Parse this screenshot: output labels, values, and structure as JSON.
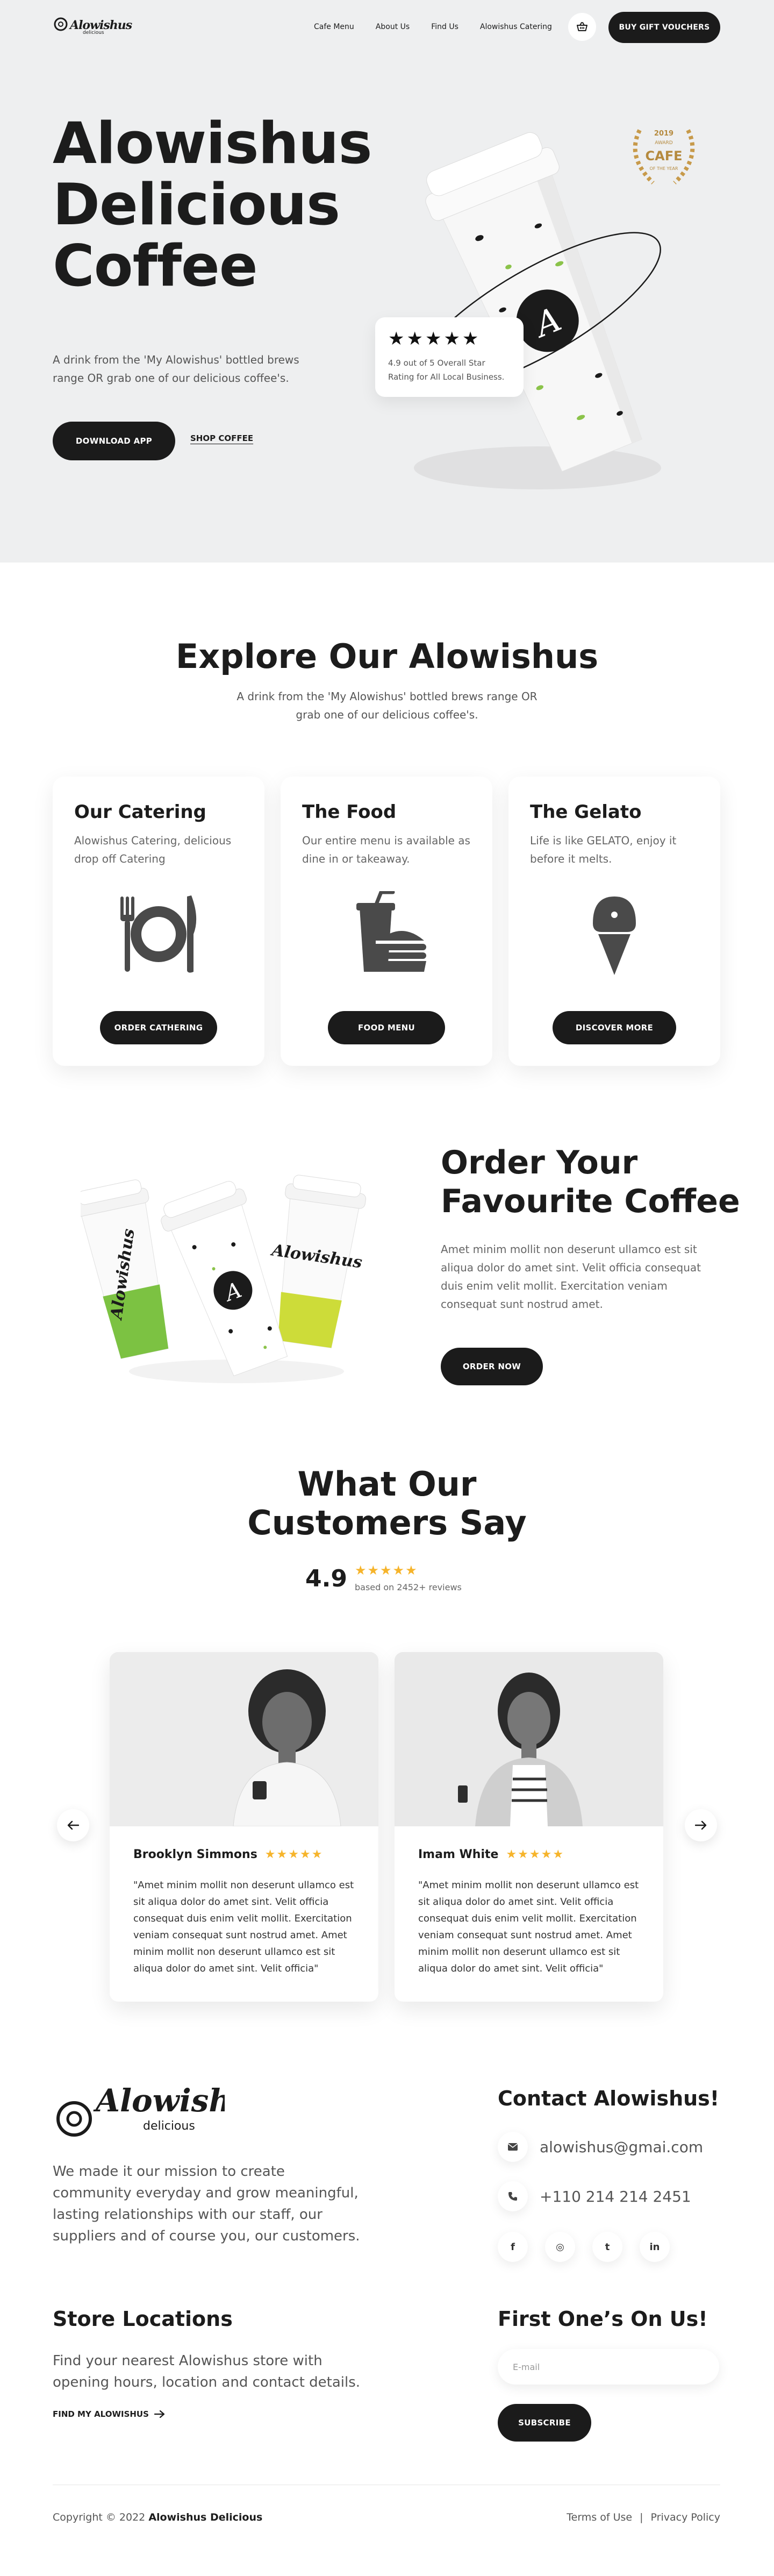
{
  "header": {
    "logo_script": "Alowishus",
    "logo_sub": "delicious",
    "nav": [
      "Cafe Menu",
      "About Us",
      "Find Us",
      "Alowishus Catering"
    ],
    "gift_button": "BUY GIFT VOUCHERS"
  },
  "hero": {
    "title_lines": [
      "Alowishus",
      "Delicious",
      "Coffee"
    ],
    "description": "A drink from the 'My Alowishus' bottled brews range OR grab one of our delicious coffee's.",
    "download_button": "DOWNLOAD APP",
    "shop_link": "SHOP COFFEE",
    "award_lines": [
      "2019",
      "AWARD",
      "CAFE",
      "OF THE YEAR"
    ],
    "rating_stars": "★★★★★",
    "rating_text": "4.9 out of 5 Overall Star Rating for All Local Business."
  },
  "explore": {
    "title": "Explore Our Alowishus",
    "description": "A drink from the 'My Alowishus' bottled brews range OR grab one of our delicious coffee's.",
    "cards": [
      {
        "title": "Our Catering",
        "text": "Alowishus Catering, delicious drop off Catering",
        "button": "ORDER CATHERING",
        "icon": "plate-cutlery-icon"
      },
      {
        "title": "The Food",
        "text": "Our entire menu is available as dine in or takeaway.",
        "button": "FOOD MENU",
        "icon": "burger-drink-icon"
      },
      {
        "title": "The Gelato",
        "text": "Life is like GELATO, enjoy it before it melts.",
        "button": "DISCOVER MORE",
        "icon": "ice-cream-icon"
      }
    ]
  },
  "order": {
    "title_lines": [
      "Order Your",
      "Favourite Coffee"
    ],
    "description": "Amet minim mollit non deserunt ullamco est sit aliqua dolor do amet sint. Velit officia consequat duis enim velit mollit. Exercitation veniam consequat sunt nostrud amet.",
    "button": "ORDER NOW"
  },
  "testimonials": {
    "title_lines": [
      "What Our",
      "Customers Say"
    ],
    "score": "4.9",
    "stars": "★★★★★",
    "reviews": "based on 2452+ reviews",
    "items": [
      {
        "name": "Brooklyn Simmons",
        "stars": "★★★★★",
        "quote": "\"Amet minim mollit non deserunt ullamco est sit aliqua dolor do amet sint. Velit officia consequat duis enim velit mollit. Exercitation veniam consequat sunt nostrud amet. Amet minim mollit non deserunt ullamco est sit aliqua dolor do amet sint. Velit officia\""
      },
      {
        "name": "Imam White",
        "stars": "★★★★★",
        "quote": "\"Amet minim mollit non deserunt ullamco est sit aliqua dolor do amet sint. Velit officia consequat duis enim velit mollit. Exercitation veniam consequat sunt nostrud amet. Amet minim mollit non deserunt ullamco est sit aliqua dolor do amet sint. Velit officia\""
      }
    ]
  },
  "footer": {
    "logo_script": "Alowishus",
    "logo_sub": "delicious",
    "about": "We made it our mission to create community everyday and grow meaningful, lasting relationships with our staff, our suppliers and of course you, our customers.",
    "contact_title": "Contact Alowishus!",
    "email": "alowishus@gmai.com",
    "phone": "+110 214 214 2451",
    "socials": [
      "f",
      "◎",
      "t",
      "in"
    ],
    "store_title": "Store Locations",
    "store_desc": "Find your nearest Alowishus store with opening hours, location and contact details.",
    "find_link": "FIND MY ALOWISHUS",
    "first_title": "First One’s On Us!",
    "email_placeholder": "E-mail",
    "subscribe": "SUBSCRIBE",
    "copyright_prefix": "Copyright © 2022",
    "copyright_brand": "Alowishus Delicious",
    "terms": "Terms of Use",
    "separator": "|",
    "privacy": "Privacy Policy"
  },
  "colors": {
    "accent": "#1b1b1b",
    "hero_bg": "#eeeff0",
    "star": "#f6b42b",
    "green": "#7cc242",
    "lime": "#cddc39"
  }
}
